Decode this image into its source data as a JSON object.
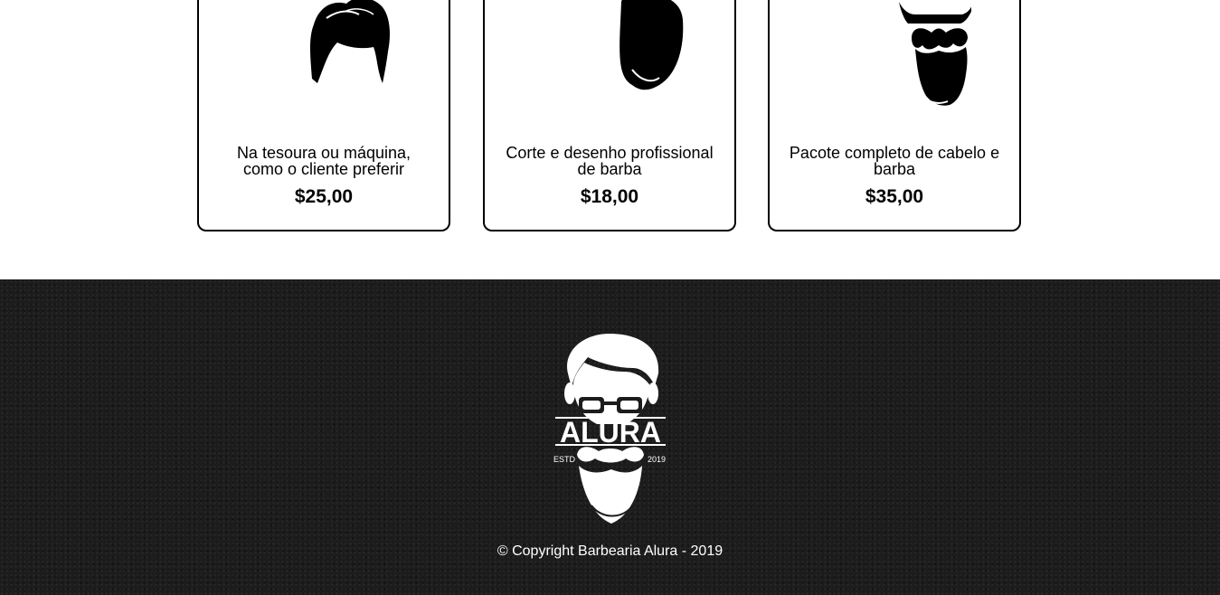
{
  "products": [
    {
      "description": "Na tesoura ou máquina, como o cliente preferir",
      "price": "$25,00",
      "icon": "hair-icon"
    },
    {
      "description": "Corte e desenho profissional de barba",
      "price": "$18,00",
      "icon": "beard-icon"
    },
    {
      "description": "Pacote completo de cabelo e barba",
      "price": "$35,00",
      "icon": "hair-and-beard-icon"
    }
  ],
  "footer": {
    "logo": {
      "brand": "ALURA",
      "left_text": "ESTD",
      "right_text": "2019"
    },
    "copyright": "© Copyright Barbearia Alura - 2019"
  },
  "colors": {
    "footer_bg": "#1c1c1c",
    "text": "#000000",
    "footer_text": "#ffffff"
  }
}
